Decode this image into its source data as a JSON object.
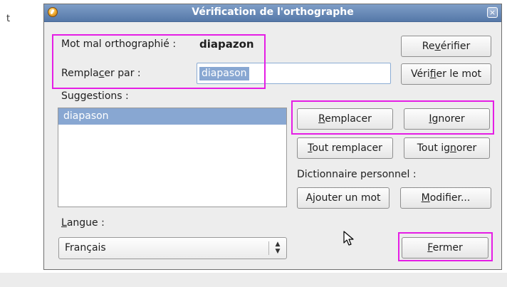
{
  "background": {
    "letter": "t"
  },
  "dialog": {
    "title": "Vérification de l'orthographe",
    "close_glyph": "×",
    "misspelled": {
      "label": "Mot mal orthographié :",
      "word": "diapazon"
    },
    "replace": {
      "label_pre": "Rempla",
      "label_u": "c",
      "label_post": "er par :",
      "value": "diapason"
    },
    "suggestions": {
      "label": "Suggestions :",
      "items": [
        "diapason"
      ]
    },
    "buttons": {
      "recheck": {
        "pre": "Re",
        "u": "v",
        "post": "érifier"
      },
      "check_word": {
        "pre": "Véri",
        "u": "f",
        "post": "ier le mot"
      },
      "replace": {
        "pre": "",
        "u": "R",
        "post": "emplacer"
      },
      "ignore": {
        "pre": "",
        "u": "I",
        "post": "gnorer"
      },
      "replace_all": {
        "pre": "",
        "u": "T",
        "post": "out remplacer"
      },
      "ignore_all": {
        "pre": "Tout ig",
        "u": "n",
        "post": "orer"
      },
      "add_word": {
        "pre": "A",
        "u": "j",
        "post": "outer un mot"
      },
      "modify": {
        "pre": "",
        "u": "M",
        "post": "odifier..."
      },
      "close": {
        "pre": "",
        "u": "F",
        "post": "ermer"
      }
    },
    "personal_dictionary": {
      "label": "Dictionnaire personnel :"
    },
    "language": {
      "label_u": "L",
      "label_post": "angue :",
      "value": "Français"
    }
  },
  "colors": {
    "highlight": "#e51ee5",
    "selection": "#88a7d2",
    "titlebar": "#6a8cbb"
  }
}
